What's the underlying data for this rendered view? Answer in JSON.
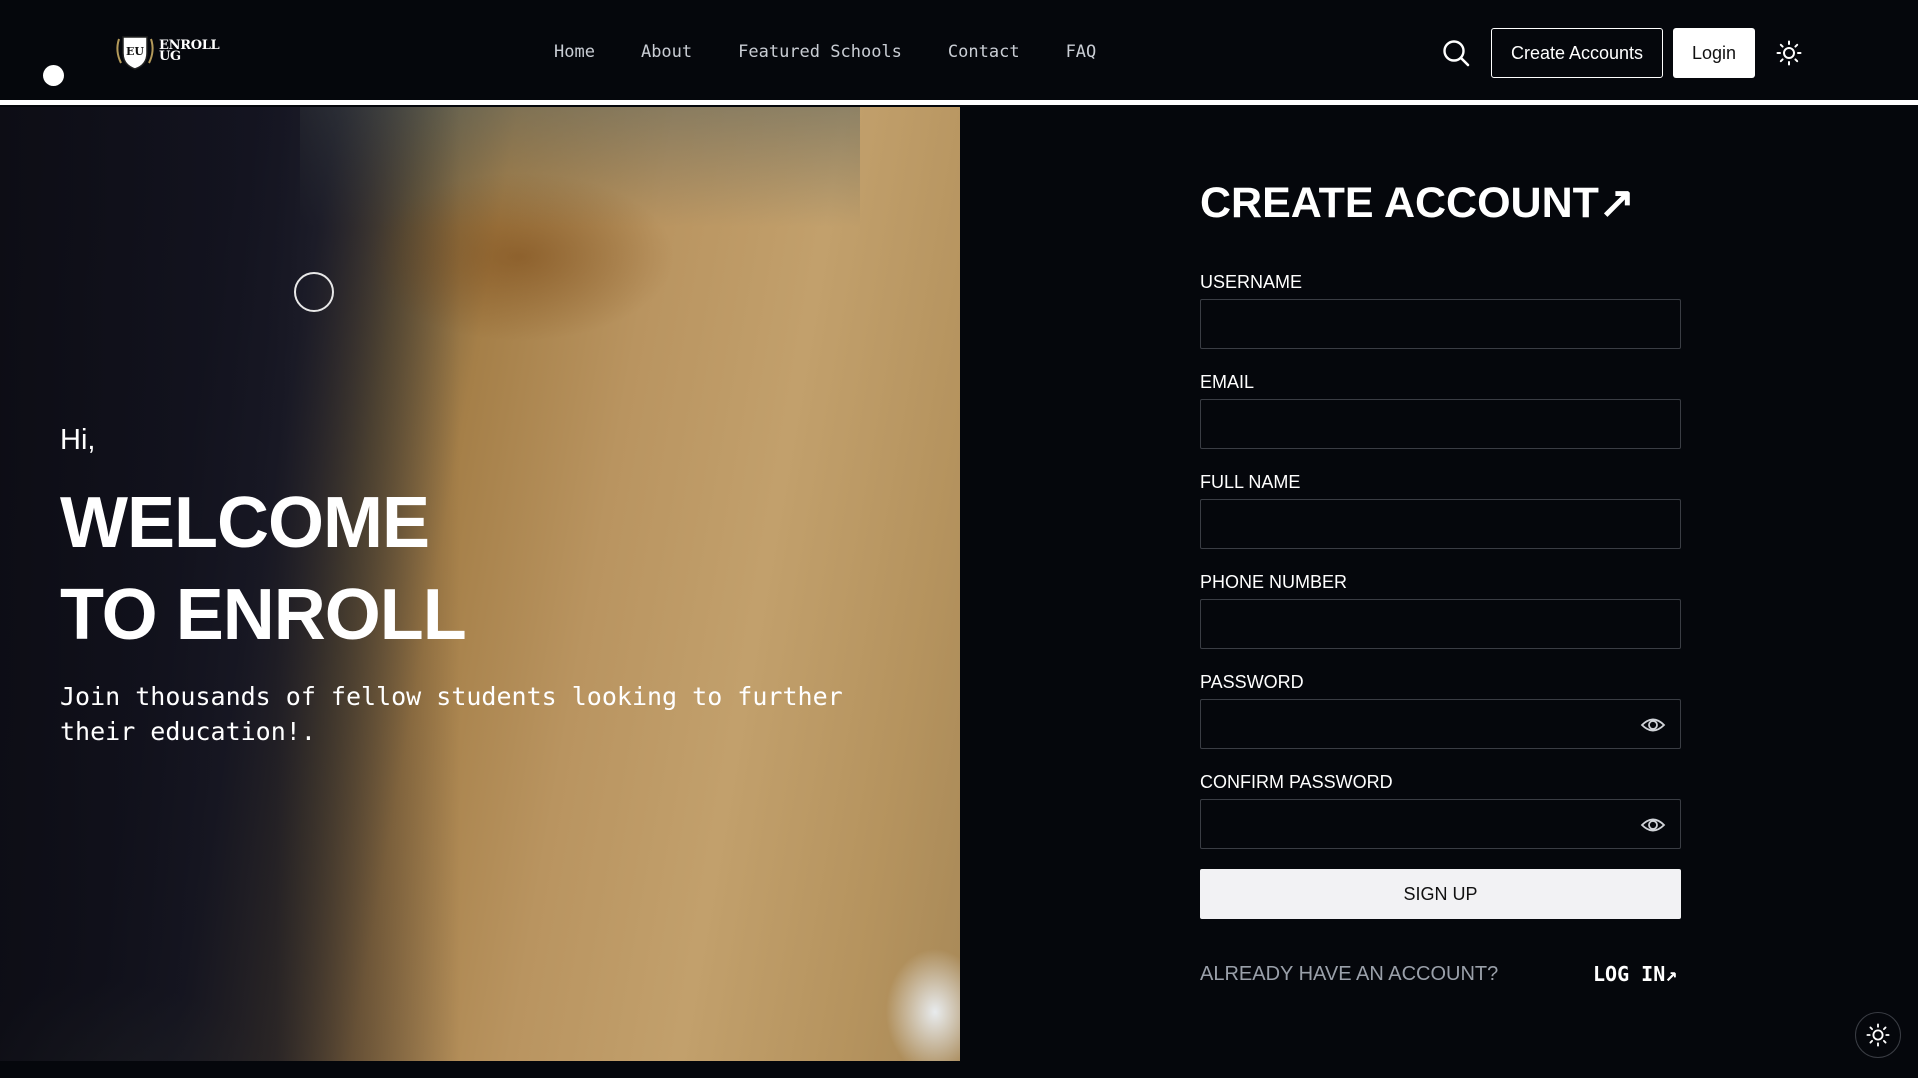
{
  "header": {
    "logo_line1": "ENROLL",
    "logo_line2": "UG",
    "logo_crest_text": "EU",
    "nav": [
      "Home",
      "About",
      "Featured Schools",
      "Contact",
      "FAQ"
    ],
    "create_accounts_label": "Create Accounts",
    "login_label": "Login",
    "search_icon": "search-icon",
    "theme_icon": "sun-icon"
  },
  "hero": {
    "greeting": "Hi,",
    "welcome_line1": "WELCOME",
    "welcome_line2": "TO ENROLL",
    "subtitle": "Join thousands of fellow students looking to further their education!."
  },
  "form": {
    "title": "CREATE ACCOUNT↗",
    "fields": [
      {
        "label": "USERNAME",
        "value": ""
      },
      {
        "label": "EMAIL",
        "value": ""
      },
      {
        "label": "FULL NAME",
        "value": ""
      },
      {
        "label": "PHONE NUMBER",
        "value": ""
      },
      {
        "label": "PASSWORD",
        "value": ""
      },
      {
        "label": "CONFIRM PASSWORD",
        "value": ""
      }
    ],
    "submit_label": "SIGN UP",
    "already_text": "ALREADY HAVE AN ACCOUNT?",
    "login_link": "LOG IN↗"
  },
  "colors": {
    "background": "#05070c",
    "foreground": "#ffffff",
    "muted": "#9aa0aa"
  }
}
